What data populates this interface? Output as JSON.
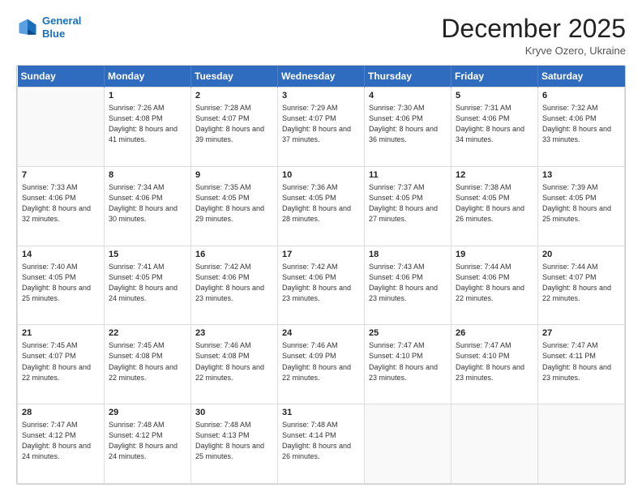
{
  "logo": {
    "line1": "General",
    "line2": "Blue"
  },
  "header": {
    "month": "December 2025",
    "location": "Kryve Ozero, Ukraine"
  },
  "weekdays": [
    "Sunday",
    "Monday",
    "Tuesday",
    "Wednesday",
    "Thursday",
    "Friday",
    "Saturday"
  ],
  "weeks": [
    [
      {
        "day": "",
        "sunrise": "",
        "sunset": "",
        "daylight": ""
      },
      {
        "day": "1",
        "sunrise": "Sunrise: 7:26 AM",
        "sunset": "Sunset: 4:08 PM",
        "daylight": "Daylight: 8 hours and 41 minutes."
      },
      {
        "day": "2",
        "sunrise": "Sunrise: 7:28 AM",
        "sunset": "Sunset: 4:07 PM",
        "daylight": "Daylight: 8 hours and 39 minutes."
      },
      {
        "day": "3",
        "sunrise": "Sunrise: 7:29 AM",
        "sunset": "Sunset: 4:07 PM",
        "daylight": "Daylight: 8 hours and 37 minutes."
      },
      {
        "day": "4",
        "sunrise": "Sunrise: 7:30 AM",
        "sunset": "Sunset: 4:06 PM",
        "daylight": "Daylight: 8 hours and 36 minutes."
      },
      {
        "day": "5",
        "sunrise": "Sunrise: 7:31 AM",
        "sunset": "Sunset: 4:06 PM",
        "daylight": "Daylight: 8 hours and 34 minutes."
      },
      {
        "day": "6",
        "sunrise": "Sunrise: 7:32 AM",
        "sunset": "Sunset: 4:06 PM",
        "daylight": "Daylight: 8 hours and 33 minutes."
      }
    ],
    [
      {
        "day": "7",
        "sunrise": "Sunrise: 7:33 AM",
        "sunset": "Sunset: 4:06 PM",
        "daylight": "Daylight: 8 hours and 32 minutes."
      },
      {
        "day": "8",
        "sunrise": "Sunrise: 7:34 AM",
        "sunset": "Sunset: 4:06 PM",
        "daylight": "Daylight: 8 hours and 30 minutes."
      },
      {
        "day": "9",
        "sunrise": "Sunrise: 7:35 AM",
        "sunset": "Sunset: 4:05 PM",
        "daylight": "Daylight: 8 hours and 29 minutes."
      },
      {
        "day": "10",
        "sunrise": "Sunrise: 7:36 AM",
        "sunset": "Sunset: 4:05 PM",
        "daylight": "Daylight: 8 hours and 28 minutes."
      },
      {
        "day": "11",
        "sunrise": "Sunrise: 7:37 AM",
        "sunset": "Sunset: 4:05 PM",
        "daylight": "Daylight: 8 hours and 27 minutes."
      },
      {
        "day": "12",
        "sunrise": "Sunrise: 7:38 AM",
        "sunset": "Sunset: 4:05 PM",
        "daylight": "Daylight: 8 hours and 26 minutes."
      },
      {
        "day": "13",
        "sunrise": "Sunrise: 7:39 AM",
        "sunset": "Sunset: 4:05 PM",
        "daylight": "Daylight: 8 hours and 25 minutes."
      }
    ],
    [
      {
        "day": "14",
        "sunrise": "Sunrise: 7:40 AM",
        "sunset": "Sunset: 4:05 PM",
        "daylight": "Daylight: 8 hours and 25 minutes."
      },
      {
        "day": "15",
        "sunrise": "Sunrise: 7:41 AM",
        "sunset": "Sunset: 4:05 PM",
        "daylight": "Daylight: 8 hours and 24 minutes."
      },
      {
        "day": "16",
        "sunrise": "Sunrise: 7:42 AM",
        "sunset": "Sunset: 4:06 PM",
        "daylight": "Daylight: 8 hours and 23 minutes."
      },
      {
        "day": "17",
        "sunrise": "Sunrise: 7:42 AM",
        "sunset": "Sunset: 4:06 PM",
        "daylight": "Daylight: 8 hours and 23 minutes."
      },
      {
        "day": "18",
        "sunrise": "Sunrise: 7:43 AM",
        "sunset": "Sunset: 4:06 PM",
        "daylight": "Daylight: 8 hours and 23 minutes."
      },
      {
        "day": "19",
        "sunrise": "Sunrise: 7:44 AM",
        "sunset": "Sunset: 4:06 PM",
        "daylight": "Daylight: 8 hours and 22 minutes."
      },
      {
        "day": "20",
        "sunrise": "Sunrise: 7:44 AM",
        "sunset": "Sunset: 4:07 PM",
        "daylight": "Daylight: 8 hours and 22 minutes."
      }
    ],
    [
      {
        "day": "21",
        "sunrise": "Sunrise: 7:45 AM",
        "sunset": "Sunset: 4:07 PM",
        "daylight": "Daylight: 8 hours and 22 minutes."
      },
      {
        "day": "22",
        "sunrise": "Sunrise: 7:45 AM",
        "sunset": "Sunset: 4:08 PM",
        "daylight": "Daylight: 8 hours and 22 minutes."
      },
      {
        "day": "23",
        "sunrise": "Sunrise: 7:46 AM",
        "sunset": "Sunset: 4:08 PM",
        "daylight": "Daylight: 8 hours and 22 minutes."
      },
      {
        "day": "24",
        "sunrise": "Sunrise: 7:46 AM",
        "sunset": "Sunset: 4:09 PM",
        "daylight": "Daylight: 8 hours and 22 minutes."
      },
      {
        "day": "25",
        "sunrise": "Sunrise: 7:47 AM",
        "sunset": "Sunset: 4:10 PM",
        "daylight": "Daylight: 8 hours and 23 minutes."
      },
      {
        "day": "26",
        "sunrise": "Sunrise: 7:47 AM",
        "sunset": "Sunset: 4:10 PM",
        "daylight": "Daylight: 8 hours and 23 minutes."
      },
      {
        "day": "27",
        "sunrise": "Sunrise: 7:47 AM",
        "sunset": "Sunset: 4:11 PM",
        "daylight": "Daylight: 8 hours and 23 minutes."
      }
    ],
    [
      {
        "day": "28",
        "sunrise": "Sunrise: 7:47 AM",
        "sunset": "Sunset: 4:12 PM",
        "daylight": "Daylight: 8 hours and 24 minutes."
      },
      {
        "day": "29",
        "sunrise": "Sunrise: 7:48 AM",
        "sunset": "Sunset: 4:12 PM",
        "daylight": "Daylight: 8 hours and 24 minutes."
      },
      {
        "day": "30",
        "sunrise": "Sunrise: 7:48 AM",
        "sunset": "Sunset: 4:13 PM",
        "daylight": "Daylight: 8 hours and 25 minutes."
      },
      {
        "day": "31",
        "sunrise": "Sunrise: 7:48 AM",
        "sunset": "Sunset: 4:14 PM",
        "daylight": "Daylight: 8 hours and 26 minutes."
      },
      {
        "day": "",
        "sunrise": "",
        "sunset": "",
        "daylight": ""
      },
      {
        "day": "",
        "sunrise": "",
        "sunset": "",
        "daylight": ""
      },
      {
        "day": "",
        "sunrise": "",
        "sunset": "",
        "daylight": ""
      }
    ]
  ]
}
